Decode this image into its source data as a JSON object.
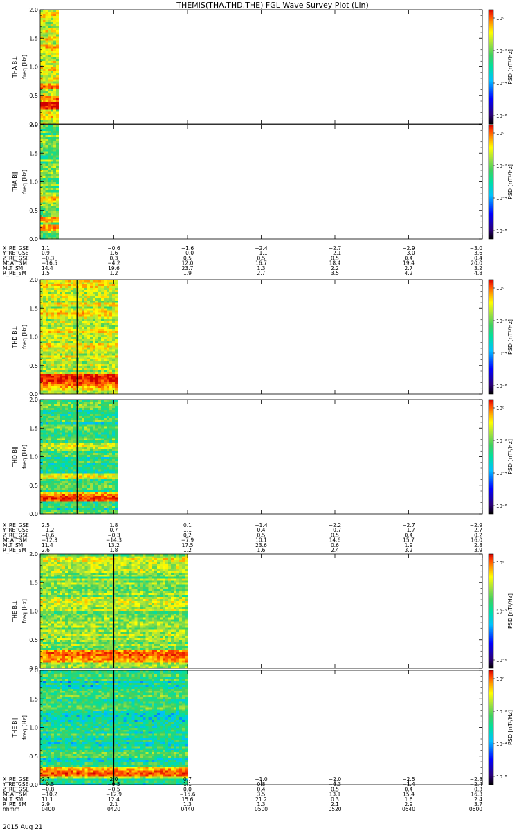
{
  "title": "THEMIS(THA,THD,THE) FGL Wave Survey Plot (Lin)",
  "footer": {
    "date": "2015 Aug 21"
  },
  "chart_data": {
    "type": "heatmap",
    "title": "THEMIS(THA,THD,THE) FGL Wave Survey Plot (Lin)",
    "x_ticks": [
      "0400",
      "0420",
      "0440",
      "0500",
      "0520",
      "0540",
      "0600"
    ],
    "x_label": "hhmm",
    "ylim": [
      0,
      2
    ],
    "y_ticks": [
      "0.0",
      "0.5",
      "1.0",
      "1.5",
      "2.0"
    ],
    "colorbar_scale": "log",
    "colormap": [
      "#000000",
      "#2b0077",
      "#0000ff",
      "#00c0ff",
      "#00e0a0",
      "#40d060",
      "#a0e040",
      "#ffff00",
      "#ffa000",
      "#ff4000",
      "#d00000"
    ],
    "panels": [
      {
        "probe": "THA",
        "ylabel": "THA B⊥",
        "yunit": "freq [Hz]",
        "zlabel": "PSD [nT²/Hz]",
        "zticks": [
          "10⁻⁶",
          "10⁻⁴",
          "10⁻²",
          "10⁰"
        ],
        "data_end_time": "0405",
        "marker_time": null,
        "base_level": 0.66,
        "bands": [
          {
            "f": 0.3,
            "level": 0.97
          },
          {
            "f": 0.35,
            "level": 1.0
          },
          {
            "f": 0.45,
            "level": 0.85
          },
          {
            "f": 0.65,
            "level": 0.88
          },
          {
            "f": 1.35,
            "level": 0.78
          },
          {
            "f": 1.9,
            "level": 0.75
          }
        ]
      },
      {
        "probe": "THA",
        "ylabel": "THA B∥",
        "yunit": "freq [Hz]",
        "zlabel": "PSD [nT²/Hz]",
        "zticks": [
          "10⁻⁸",
          "10⁻⁴",
          "10⁻²",
          "10⁰"
        ],
        "data_end_time": "0405",
        "marker_time": null,
        "base_level": 0.55,
        "bands": [
          {
            "f": 0.2,
            "level": 0.82
          },
          {
            "f": 0.35,
            "level": 0.84
          },
          {
            "f": 0.7,
            "level": 0.78
          }
        ]
      },
      {
        "probe": "THD",
        "ylabel": "THD B⊥",
        "yunit": "freq [Hz]",
        "zlabel": "PSD [nT²/Hz]",
        "zticks": [
          "10⁻⁶",
          "10⁻⁴",
          "10⁻²",
          "10⁰"
        ],
        "data_end_time": "0421",
        "marker_time": "0410",
        "base_level": 0.64,
        "bands": [
          {
            "f": 0.15,
            "level": 0.83
          },
          {
            "f": 0.22,
            "level": 0.92
          },
          {
            "f": 0.28,
            "level": 1.0
          },
          {
            "f": 1.4,
            "level": 0.76
          },
          {
            "f": 1.9,
            "level": 0.74
          }
        ]
      },
      {
        "probe": "THD",
        "ylabel": "THD B∥",
        "yunit": "freq [Hz]",
        "zlabel": "PSD [nT²/Hz]",
        "zticks": [
          "10⁻⁶",
          "10⁻⁴",
          "10⁻²",
          "10⁰"
        ],
        "data_end_time": "0421",
        "marker_time": "0410",
        "base_level": 0.47,
        "bands": [
          {
            "f": 0.28,
            "level": 0.94
          },
          {
            "f": 0.35,
            "level": 0.8
          },
          {
            "f": 0.65,
            "level": 0.72
          },
          {
            "f": 1.2,
            "level": 0.68
          }
        ]
      },
      {
        "probe": "THE",
        "ylabel": "THE B⊥",
        "yunit": "freq [Hz]",
        "zlabel": "PSD [nT²/Hz]",
        "zticks": [
          "10⁻⁶",
          "10⁻²",
          "10⁰"
        ],
        "data_end_time": "0440",
        "marker_time": "0420",
        "base_level": 0.58,
        "bands": [
          {
            "f": 0.15,
            "level": 0.84
          },
          {
            "f": 0.25,
            "level": 0.9
          },
          {
            "f": 1.9,
            "level": 0.72
          }
        ]
      },
      {
        "probe": "THE",
        "ylabel": "THE B∥",
        "yunit": "freq [Hz]",
        "zlabel": "PSD [nT²/Hz]",
        "zticks": [
          "10⁻⁸",
          "10⁻⁴",
          "10⁻²",
          "10⁰"
        ],
        "data_end_time": "0440",
        "marker_time": "0420",
        "base_level": 0.45,
        "bands": [
          {
            "f": 0.15,
            "level": 0.66
          },
          {
            "f": 0.2,
            "level": 0.9
          },
          {
            "f": 0.25,
            "level": 0.82
          }
        ]
      }
    ],
    "ephemeris": [
      {
        "probe": "THA",
        "rows": [
          {
            "label": "X_RE_GSE",
            "values": [
              "1.1",
              "−0.6",
              "−1.6",
              "−2.4",
              "−2.7",
              "−2.9",
              "−3.0"
            ]
          },
          {
            "label": "Y_RE_GSE",
            "values": [
              "0.9",
              "1.6",
              "−0.0",
              "−1.1",
              "−2.1",
              "−3.0",
              "−3.6"
            ]
          },
          {
            "label": "Z_RE_GSE",
            "values": [
              "−0.3",
              "0.3",
              "0.5",
              "0.5",
              "0.5",
              "0.4",
              "0.4"
            ]
          },
          {
            "label": "MLAT_SM",
            "values": [
              "−16.5",
              "−4.2",
              "12.0",
              "16.7",
              "18.4",
              "19.4",
              "20.0"
            ]
          },
          {
            "label": "MLT_SM",
            "values": [
              "14.4",
              "19.6",
              "23.7",
              "1.3",
              "2.2",
              "2.7",
              "3.2"
            ]
          },
          {
            "label": "R_RE_SM",
            "values": [
              "1.5",
              "1.2",
              "1.9",
              "2.7",
              "3.5",
              "4.2",
              "4.8"
            ]
          }
        ]
      },
      {
        "probe": "THD",
        "rows": [
          {
            "label": "X_RE_GSE",
            "values": [
              "2.5",
              "1.8",
              "0.1",
              "−1.4",
              "−2.2",
              "−2.7",
              "−2.9"
            ]
          },
          {
            "label": "Y_RE_GSE",
            "values": [
              "−1.2",
              "0.7",
              "1.1",
              "0.4",
              "−0.7",
              "−1.7",
              "−2.7"
            ]
          },
          {
            "label": "Z_RE_GSE",
            "values": [
              "−0.6",
              "−0.3",
              "0.2",
              "0.5",
              "0.5",
              "0.4",
              "0.2"
            ]
          },
          {
            "label": "MLAT_SM",
            "values": [
              "−12.3",
              "−14.3",
              "−7.9",
              "10.1",
              "14.6",
              "15.7",
              "16.0"
            ]
          },
          {
            "label": "MLT_SM",
            "values": [
              "11.4",
              "13.2",
              "17.5",
              "23.6",
              "0.6",
              "1.9",
              "2.8"
            ]
          },
          {
            "label": "R_RE_SM",
            "values": [
              "2.6",
              "1.8",
              "1.2",
              "1.6",
              "2.4",
              "3.2",
              "3.9"
            ]
          }
        ]
      },
      {
        "probe": "THE",
        "rows": [
          {
            "label": "X_RE_GSE",
            "values": [
              "2.7",
              "2.0",
              "0.7",
              "−1.0",
              "−2.0",
              "−2.5",
              "−2.8"
            ]
          },
          {
            "label": "Y_RE_GSE",
            "values": [
              "−0.5",
              "−0.5",
              "1.1",
              "0.8",
              "−0.3",
              "−1.4",
              "−2.4"
            ]
          },
          {
            "label": "Z_RE_GSE",
            "values": [
              "−0.8",
              "−0.5",
              "0.0",
              "0.4",
              "0.5",
              "0.4",
              "0.3"
            ]
          },
          {
            "label": "MLAT_SM",
            "values": [
              "−10.2",
              "−12.9",
              "−15.6",
              "3.5",
              "13.1",
              "15.4",
              "16.3"
            ]
          },
          {
            "label": "MLT_SM",
            "values": [
              "11.1",
              "12.4",
              "15.6",
              "21.2",
              "0.3",
              "1.6",
              "2.4"
            ]
          },
          {
            "label": "R_RE_SM",
            "values": [
              "2.9",
              "2.1",
              "1.3",
              "1.3",
              "2.1",
              "2.9",
              "3.7"
            ]
          }
        ],
        "time_row": {
          "label": "hhmm",
          "values": [
            "0400",
            "0420",
            "0440",
            "0500",
            "0520",
            "0540",
            "0600"
          ]
        }
      }
    ]
  }
}
